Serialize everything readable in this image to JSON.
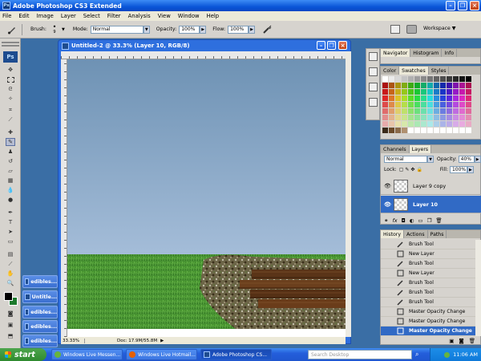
{
  "app": {
    "title": "Adobe Photoshop CS3 Extended",
    "logo": "Ps"
  },
  "menu": [
    "File",
    "Edit",
    "Image",
    "Layer",
    "Select",
    "Filter",
    "Analysis",
    "View",
    "Window",
    "Help"
  ],
  "options": {
    "brush_label": "Brush:",
    "brush_size": "9",
    "mode_label": "Mode:",
    "mode_value": "Normal",
    "opacity_label": "Opacity:",
    "opacity_value": "100%",
    "flow_label": "Flow:",
    "flow_value": "100%",
    "workspace_label": "Workspace ▼"
  },
  "minimized_windows": [
    "edibles...",
    "Untitle...",
    "edibles...",
    "edibles...",
    "edibles..."
  ],
  "document": {
    "title": "Untitled-2 @ 33.3% (Layer 10, RGB/8)",
    "zoom": "33.33%",
    "doc_info": "Doc: 17.9M/55.8M"
  },
  "navigator_panel": {
    "tabs": [
      "Navigator",
      "Histogram",
      "Info"
    ]
  },
  "swatches_panel": {
    "tabs": [
      "Color",
      "Swatches",
      "Styles"
    ]
  },
  "layers_panel": {
    "tabs": [
      "Channels",
      "Layers"
    ],
    "blend_mode": "Normal",
    "opacity_label": "Opacity:",
    "opacity_value": "40%",
    "lock_label": "Lock:",
    "fill_label": "Fill:",
    "fill_value": "100%",
    "layers": [
      {
        "name": "Layer 9 copy",
        "selected": false
      },
      {
        "name": "Layer 10",
        "selected": true
      }
    ]
  },
  "history_panel": {
    "tabs": [
      "History",
      "Actions",
      "Paths"
    ],
    "items": [
      {
        "label": "Brush Tool",
        "selected": false
      },
      {
        "label": "New Layer",
        "selected": false
      },
      {
        "label": "Brush Tool",
        "selected": false
      },
      {
        "label": "New Layer",
        "selected": false
      },
      {
        "label": "Brush Tool",
        "selected": false
      },
      {
        "label": "Brush Tool",
        "selected": false
      },
      {
        "label": "Brush Tool",
        "selected": false
      },
      {
        "label": "Master Opacity Change",
        "selected": false
      },
      {
        "label": "Master Opacity Change",
        "selected": false
      },
      {
        "label": "Master Opacity Change",
        "selected": true
      }
    ]
  },
  "taskbar": {
    "start_label": "start",
    "buttons": [
      {
        "label": "Windows Live Messen...",
        "active": false
      },
      {
        "label": "Windows Live Hotmail...",
        "active": false
      },
      {
        "label": "Adobe Photoshop CS...",
        "active": true
      }
    ],
    "search_placeholder": "Search Desktop",
    "clock": "11:06 AM"
  },
  "colors": {
    "xp_blue": "#245edb",
    "selection_blue": "#316ac5",
    "panel_gray": "#d6d3ce",
    "sky_top": "#6e92b4",
    "sky_bottom": "#b9cde6",
    "grass": "#3f8a2a",
    "wood": "#5a3418"
  }
}
